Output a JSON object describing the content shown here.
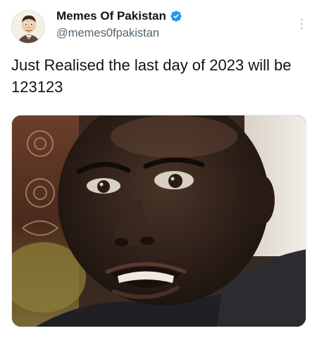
{
  "tweet": {
    "author": {
      "display_name": "Memes Of Pakistan",
      "handle": "@memes0fpakistan",
      "verified": true,
      "verified_color": "#1d9bf0",
      "avatar_icon": "cartoon-character-avatar"
    },
    "text": "Just Realised the last day of 2023 will be 123123",
    "more_icon": "more-vertical-icon",
    "media": {
      "kind": "photo",
      "icon": "reaction-meme-photo"
    }
  },
  "colors": {
    "text_primary": "#0f1419",
    "text_secondary": "#536471",
    "background": "#ffffff"
  }
}
